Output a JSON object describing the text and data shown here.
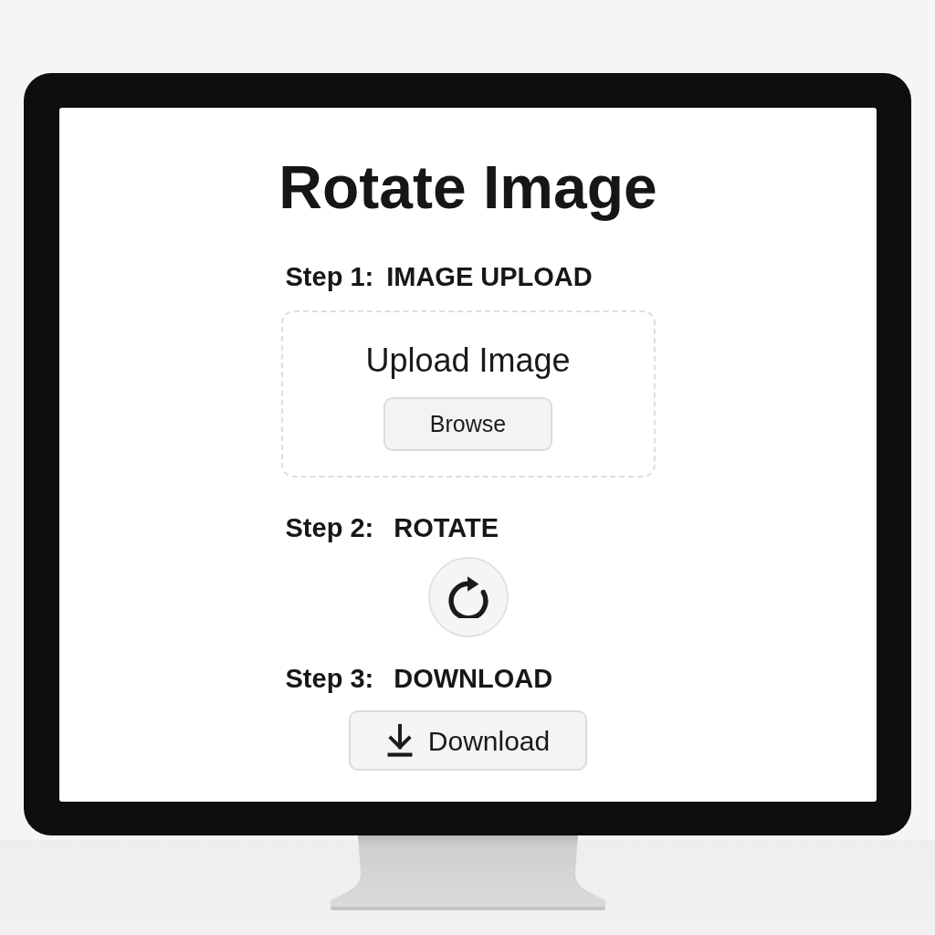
{
  "title": "Rotate Image",
  "steps": [
    {
      "kind": "upload",
      "label": "Step 1:",
      "heading": "IMAGE UPLOAD",
      "dropzone_title": "Upload Image",
      "button": "Browse"
    },
    {
      "kind": "rotate",
      "label": "Step 2:",
      "heading": "ROTATE"
    },
    {
      "kind": "download",
      "label": "Step 3:",
      "heading": "DOWNLOAD",
      "button": "Download"
    }
  ]
}
